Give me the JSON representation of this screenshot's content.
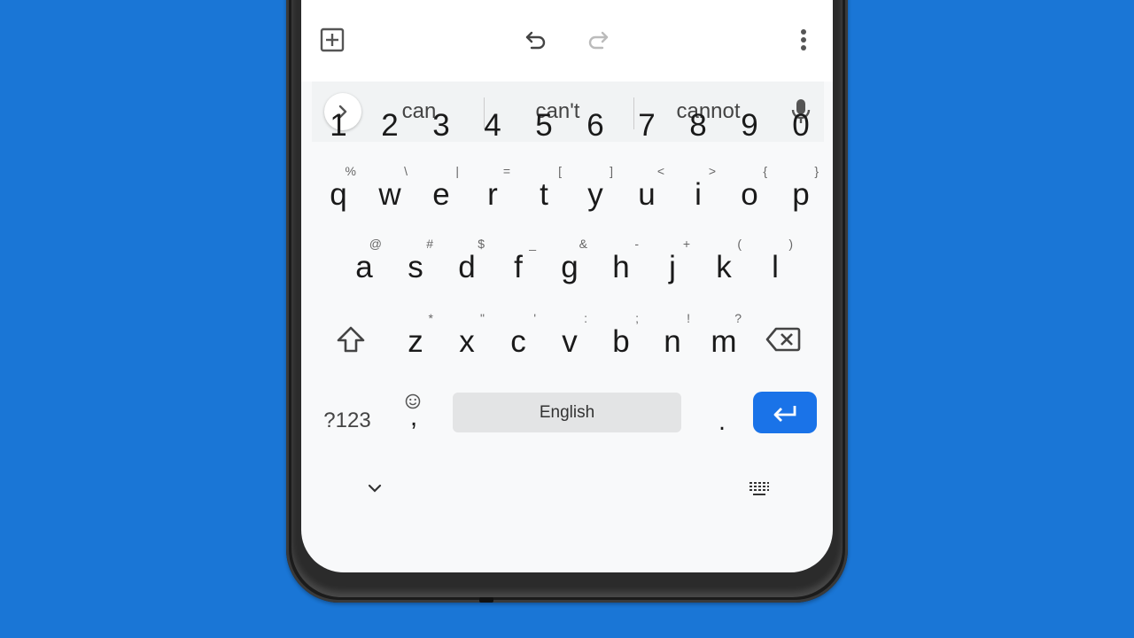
{
  "colors": {
    "background": "#1a76d6",
    "enter_key": "#1a73e8",
    "keyboard_bg": "#f8f9fa",
    "suggestion_bar": "#f1f3f4",
    "space_key": "#e3e4e5"
  },
  "toolbar": {
    "left_icon": "add-box-icon",
    "undo_icon": "undo-icon",
    "redo_icon": "redo-icon",
    "menu_icon": "more-vert-icon"
  },
  "suggestions": {
    "expand_icon": "chevron-right-icon",
    "items": [
      "can",
      "can't",
      "cannot"
    ],
    "mic_icon": "microphone-icon"
  },
  "keyboard": {
    "digits": [
      "1",
      "2",
      "3",
      "4",
      "5",
      "6",
      "7",
      "8",
      "9",
      "0"
    ],
    "row1": [
      {
        "key": "q",
        "hint": "%"
      },
      {
        "key": "w",
        "hint": "\\"
      },
      {
        "key": "e",
        "hint": "|"
      },
      {
        "key": "r",
        "hint": "="
      },
      {
        "key": "t",
        "hint": "["
      },
      {
        "key": "y",
        "hint": "]"
      },
      {
        "key": "u",
        "hint": "<"
      },
      {
        "key": "i",
        "hint": ">"
      },
      {
        "key": "o",
        "hint": "{"
      },
      {
        "key": "p",
        "hint": "}"
      }
    ],
    "row2": [
      {
        "key": "a",
        "hint": "@"
      },
      {
        "key": "s",
        "hint": "#"
      },
      {
        "key": "d",
        "hint": "$"
      },
      {
        "key": "f",
        "hint": "_"
      },
      {
        "key": "g",
        "hint": "&"
      },
      {
        "key": "h",
        "hint": "-"
      },
      {
        "key": "j",
        "hint": "+"
      },
      {
        "key": "k",
        "hint": "("
      },
      {
        "key": "l",
        "hint": ")"
      }
    ],
    "row3": [
      {
        "key": "z",
        "hint": "*"
      },
      {
        "key": "x",
        "hint": "\""
      },
      {
        "key": "c",
        "hint": "'"
      },
      {
        "key": "v",
        "hint": ":"
      },
      {
        "key": "b",
        "hint": ";"
      },
      {
        "key": "n",
        "hint": "!"
      },
      {
        "key": "m",
        "hint": "?"
      }
    ],
    "shift_icon": "shift-icon",
    "delete_icon": "backspace-icon",
    "symbols_label": "?123",
    "comma_label": ",",
    "emoji_icon": "emoji-icon",
    "space_label": "English",
    "period_label": ".",
    "enter_icon": "enter-icon"
  },
  "nav": {
    "hide_icon": "chevron-down-icon",
    "switch_keyboard_icon": "keyboard-icon"
  }
}
